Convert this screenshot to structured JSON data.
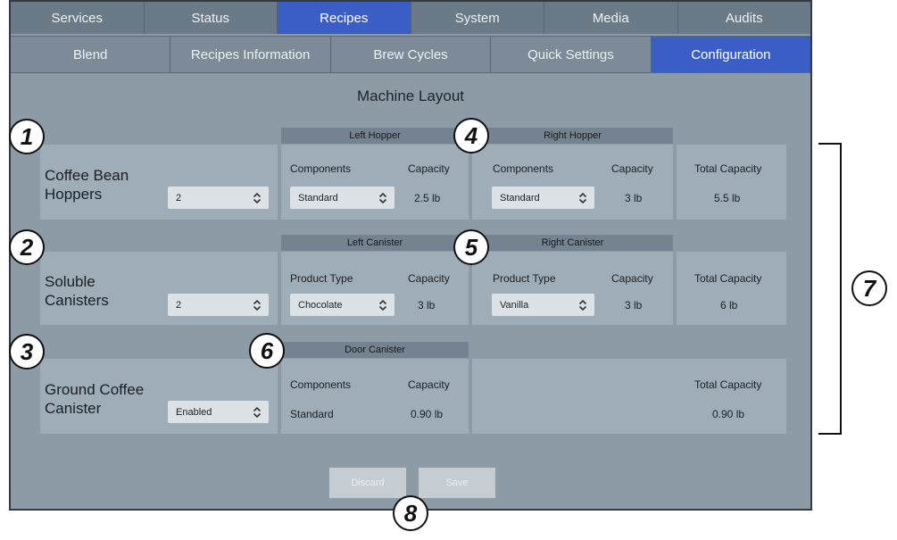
{
  "tabs_row1": [
    "Services",
    "Status",
    "Recipes",
    "System",
    "Media",
    "Audits"
  ],
  "tabs_row2": [
    "Blend",
    "Recipes Information",
    "Brew Cycles",
    "Quick Settings",
    "Configuration"
  ],
  "title": "Machine Layout",
  "hoppers": {
    "label_line1": "Coffee Bean",
    "label_line2": "Hoppers",
    "count": "2",
    "left_header": "Left Hopper",
    "right_header": "Right Hopper",
    "left_col1": "Components",
    "left_col2": "Capacity",
    "left_value": "Standard",
    "left_capacity": "2.5 lb",
    "right_col1": "Components",
    "right_col2": "Capacity",
    "right_value": "Standard",
    "right_capacity": "3 lb",
    "total_label": "Total Capacity",
    "total_value": "5.5 lb"
  },
  "canisters": {
    "label_line1": "Soluble",
    "label_line2": "Canisters",
    "count": "2",
    "left_header": "Left Canister",
    "right_header": "Right Canister",
    "left_col1": "Product Type",
    "left_col2": "Capacity",
    "left_value": "Chocolate",
    "left_capacity": "3 lb",
    "right_col1": "Product Type",
    "right_col2": "Capacity",
    "right_value": "Vanilla",
    "right_capacity": "3 lb",
    "total_label": "Total Capacity",
    "total_value": "6 lb"
  },
  "ground": {
    "label_line1": "Ground Coffee",
    "label_line2": "Canister",
    "status": "Enabled",
    "door_header": "Door Canister",
    "col1": "Components",
    "col2": "Capacity",
    "component_value": "Standard",
    "capacity_value": "0.90 lb",
    "total_label": "Total Capacity",
    "total_value": "0.90 lb"
  },
  "buttons": {
    "discard": "Discard",
    "save": "Save"
  },
  "callouts": [
    "1",
    "2",
    "3",
    "4",
    "5",
    "6",
    "7",
    "8"
  ],
  "icons": {
    "select_chevron": "chevron-updown-icon"
  },
  "colors": {
    "active_tab": "#3b5ec6",
    "screen_bg": "#8d9ba6",
    "panel": "#9fadb8"
  }
}
